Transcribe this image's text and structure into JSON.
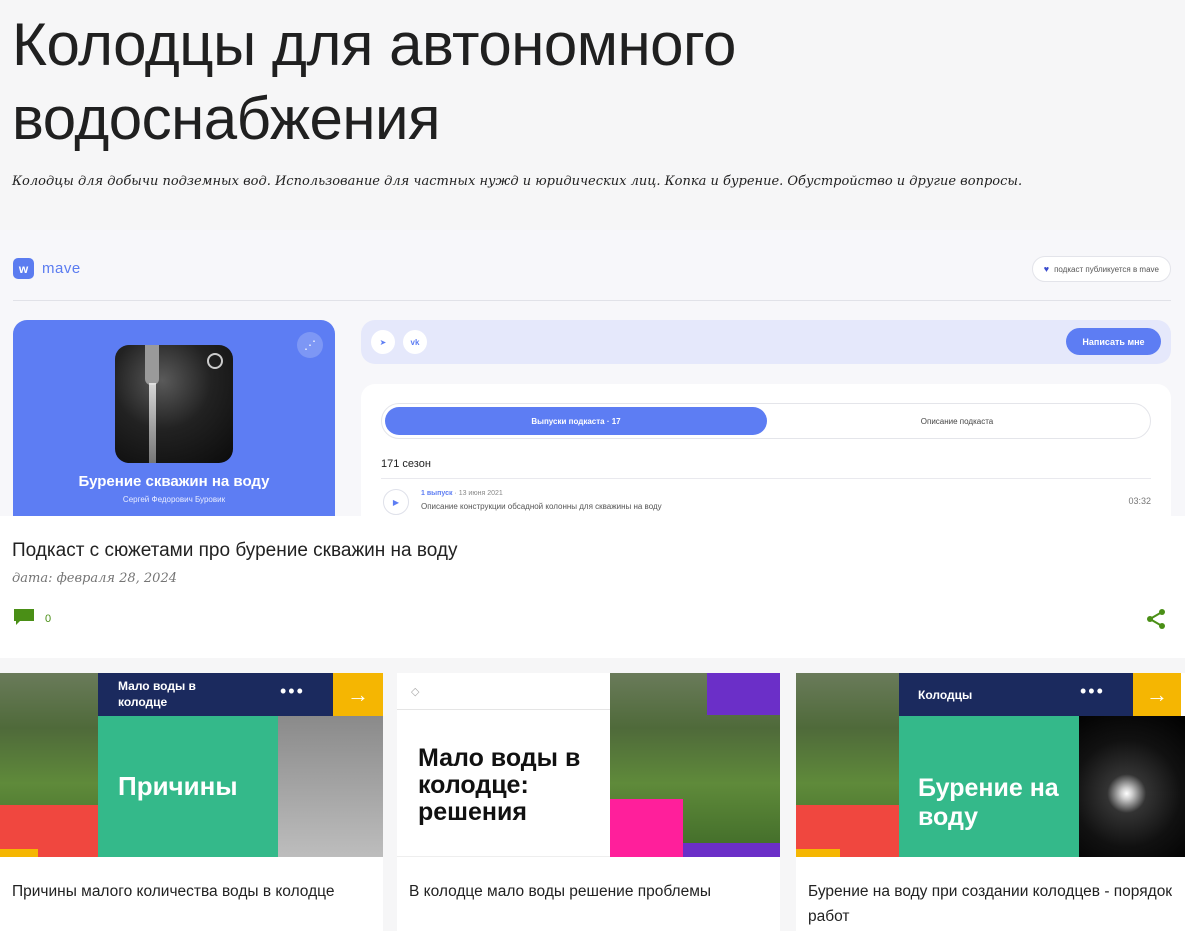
{
  "blog": {
    "title": "Колодцы для автономного водоснабжения",
    "description": "Колодцы для добычи подземных вод. Использование для частных нужд и юридических лиц. Копка и бурение. Обустройство и другие вопросы."
  },
  "hero": {
    "logo_text": "mave",
    "logo_mark": "w",
    "publish_badge": "подкаст публикуется в mave",
    "podcast_title": "Бурение скважин на воду",
    "podcast_author": "Сергей Федорович Буровик",
    "social": [
      "tg",
      "vk"
    ],
    "write_button": "Написать мне",
    "tab_active": "Выпуски подкаста · 17",
    "tab_other": "Описание подкаста",
    "season": "171 сезон",
    "episode": {
      "number": "1 выпуск",
      "date": "· 13 июня 2021",
      "description": "Описание конструкции обсадной колонны для скважины на воду",
      "duration": "03:32"
    }
  },
  "post": {
    "title": "Подкаст с сюжетами про бурение скважин на воду",
    "date": "дата: февраля 28, 2024",
    "comment_count": "0"
  },
  "related": [
    {
      "banner": "Мало воды в колодце",
      "big_text": "Причины",
      "caption": "Причины малого количества воды в колодце"
    },
    {
      "big_text": "Мало воды в колодце: решения",
      "caption": "В колодце мало воды решение проблемы"
    },
    {
      "banner": "Колодцы",
      "big_text": "Бурение на воду",
      "caption": "Бурение на воду при создании колодцев - порядок работ"
    }
  ],
  "colors": {
    "accent_green": "#4a8f16",
    "mave_blue": "#5d7df3",
    "banner_navy": "#1b2a5e",
    "teal": "#34b98a",
    "yellow": "#f5b602"
  }
}
